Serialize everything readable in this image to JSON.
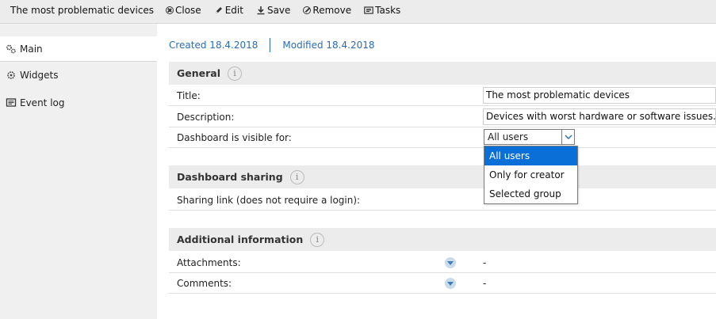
{
  "window": {
    "title": "The most problematic devices"
  },
  "toolbar": {
    "items": [
      {
        "label": "Close",
        "icon": "close-icon"
      },
      {
        "label": "Edit",
        "icon": "pencil-icon"
      },
      {
        "label": "Save",
        "icon": "save-icon"
      },
      {
        "label": "Remove",
        "icon": "remove-icon"
      },
      {
        "label": "Tasks",
        "icon": "tasks-icon"
      }
    ]
  },
  "sidebar": {
    "items": [
      {
        "label": "Main",
        "icon": "gears-icon",
        "active": true
      },
      {
        "label": "Widgets",
        "icon": "widgets-icon",
        "active": false
      },
      {
        "label": "Event log",
        "icon": "log-icon",
        "active": false
      }
    ]
  },
  "meta": {
    "created": "Created 18.4.2018",
    "modified": "Modified 18.4.2018"
  },
  "general": {
    "heading": "General",
    "title_label": "Title:",
    "title_value": "The most problematic devices",
    "description_label": "Description:",
    "description_value": "Devices with worst hardware or software issues.",
    "visibility_label": "Dashboard is visible for:",
    "visibility_selected": "All users",
    "visibility_options": [
      "All users",
      "Only for creator",
      "Selected group"
    ]
  },
  "sharing": {
    "heading": "Dashboard sharing",
    "link_label": "Sharing link (does not require a login):"
  },
  "additional": {
    "heading": "Additional information",
    "attachments_label": "Attachments:",
    "attachments_value": "-",
    "comments_label": "Comments:",
    "comments_value": "-"
  },
  "colors": {
    "accent": "#2b6cb5",
    "selected_option": "#0a6fd6",
    "section_header": "#ececec"
  }
}
